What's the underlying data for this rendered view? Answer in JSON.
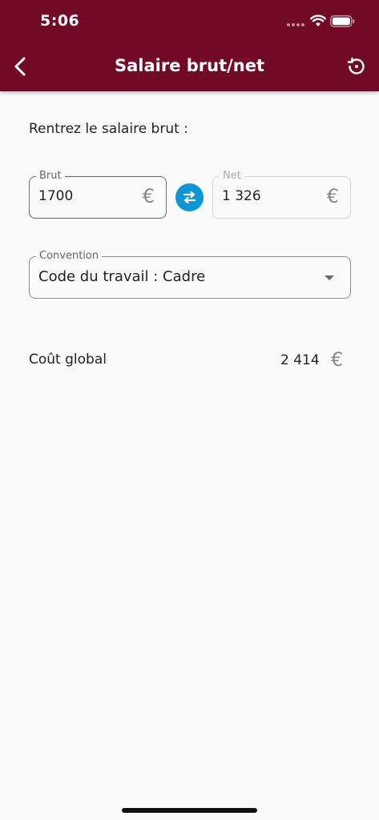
{
  "status_bar": {
    "time": "5:06"
  },
  "header": {
    "title": "Salaire brut/net"
  },
  "form": {
    "prompt": "Rentrez le salaire brut :",
    "brut": {
      "label": "Brut",
      "value": "1700",
      "currency": "€"
    },
    "net": {
      "label": "Net",
      "value": "1 326",
      "currency": "€"
    },
    "convention": {
      "label": "Convention",
      "value": "Code du travail : Cadre"
    }
  },
  "result": {
    "label": "Coût global",
    "value": "2 414",
    "currency": "€"
  },
  "colors": {
    "header": "#720a27",
    "swap_button": "#0e96d4"
  },
  "icons": {
    "back": "chevron-left-icon",
    "history": "history-icon",
    "swap": "swap-arrows-icon",
    "dropdown": "caret-down-icon"
  }
}
